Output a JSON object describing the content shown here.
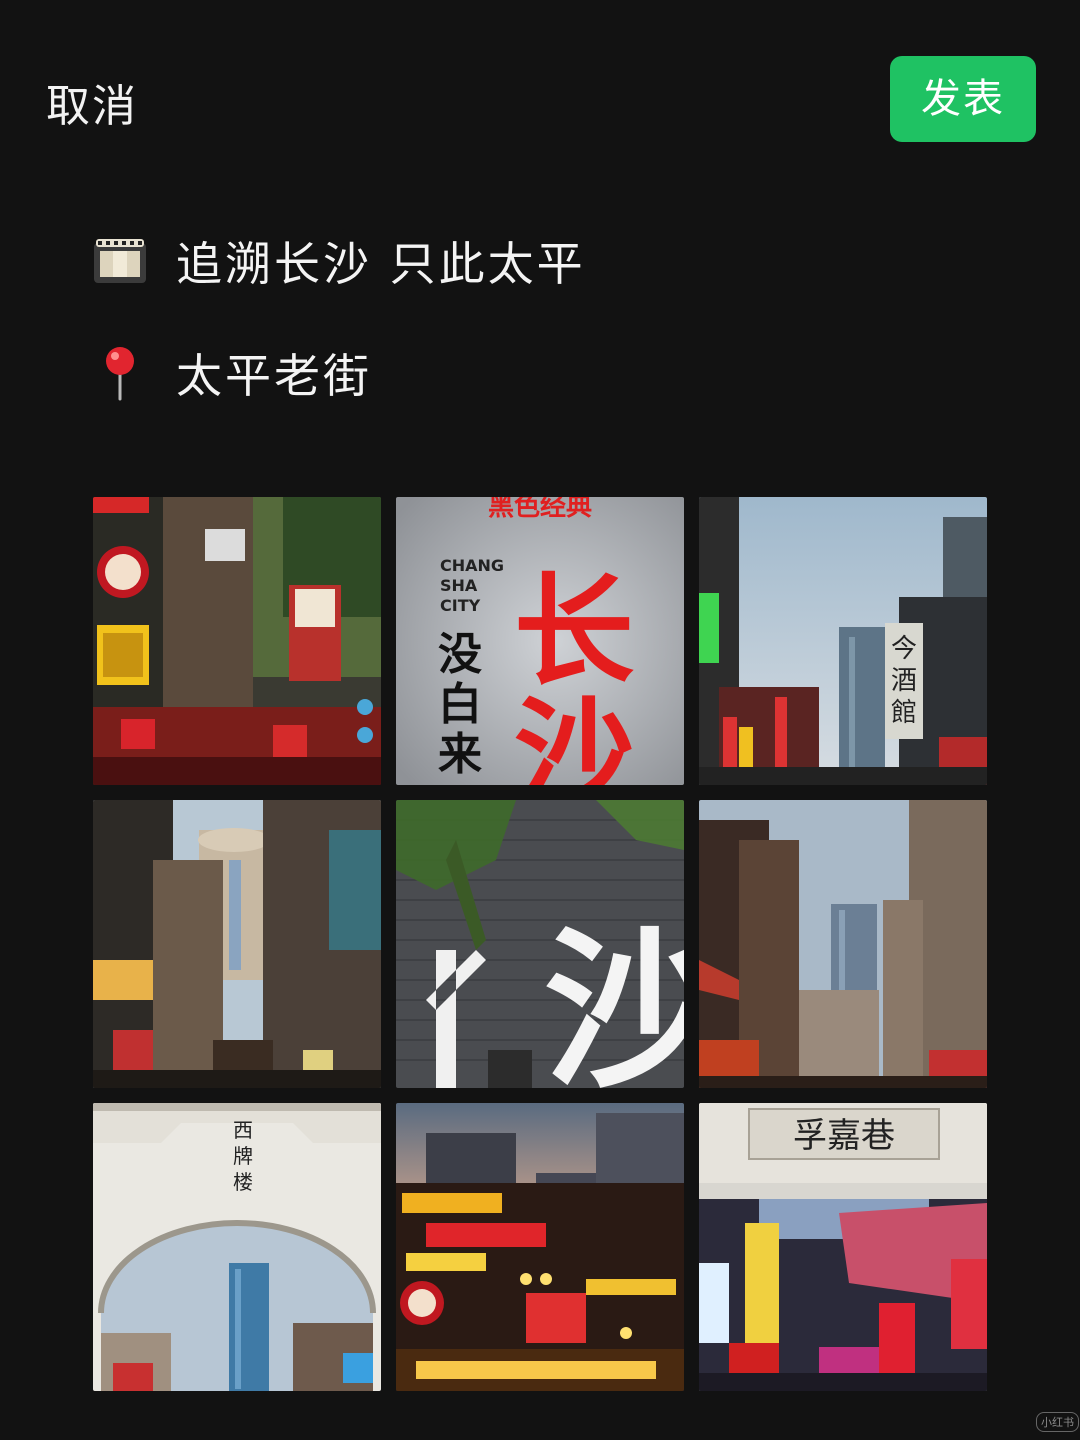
{
  "header": {
    "cancel_label": "取消",
    "publish_label": "发表",
    "accent": "#1fc263"
  },
  "post": {
    "title_icon": "film-strip-icon",
    "title": "追溯长沙  只此太平",
    "location_icon": "location-pin-icon",
    "location": "太平老街"
  },
  "photos": {
    "tiles": [
      {
        "label": "photo-1"
      },
      {
        "label": "photo-2",
        "sign_top": "黑色经典",
        "sign_en": [
          "CHANG",
          "SHA",
          "CITY"
        ],
        "sign_vertical": [
          "没",
          "白",
          "来"
        ],
        "sign_big": [
          "长",
          "沙"
        ]
      },
      {
        "label": "photo-3",
        "sign": [
          "今",
          "酒",
          "館"
        ]
      },
      {
        "label": "photo-4"
      },
      {
        "label": "photo-5",
        "wall_text": "沙"
      },
      {
        "label": "photo-6"
      },
      {
        "label": "photo-7",
        "gate_text": [
          "西",
          "牌",
          "楼"
        ]
      },
      {
        "label": "photo-8"
      },
      {
        "label": "photo-9",
        "gate_text": "孚嘉巷"
      }
    ]
  },
  "watermark": "小红书"
}
